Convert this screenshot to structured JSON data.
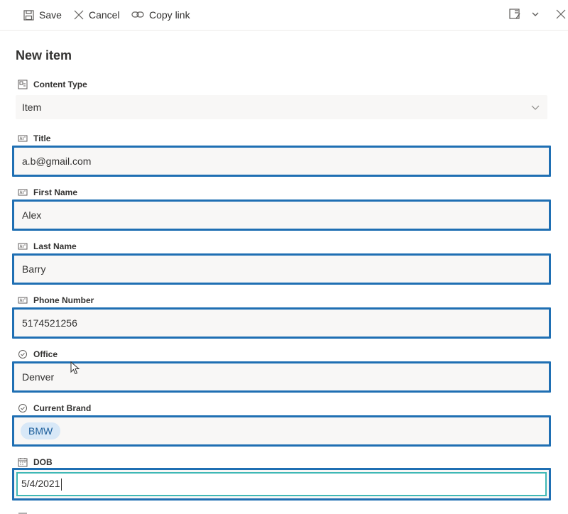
{
  "toolbar": {
    "save_label": "Save",
    "cancel_label": "Cancel",
    "copy_link_label": "Copy link"
  },
  "page_title": "New item",
  "fields": {
    "content_type": {
      "label": "Content Type",
      "value": "Item"
    },
    "title": {
      "label": "Title",
      "value": "a.b@gmail.com"
    },
    "first_name": {
      "label": "First Name",
      "value": "Alex"
    },
    "last_name": {
      "label": "Last Name",
      "value": "Barry"
    },
    "phone": {
      "label": "Phone Number",
      "value": "5174521256"
    },
    "office": {
      "label": "Office",
      "value": "Denver"
    },
    "current_brand": {
      "label": "Current Brand",
      "value": "BMW"
    },
    "dob": {
      "label": "DOB",
      "value": "5/4/2021"
    }
  },
  "colors": {
    "highlight_border": "#1f6fb3",
    "focus_border": "#3fb8b5",
    "field_background": "#f8f7f6",
    "pill_background": "#d8e8f7",
    "pill_text": "#1b5d9a"
  }
}
